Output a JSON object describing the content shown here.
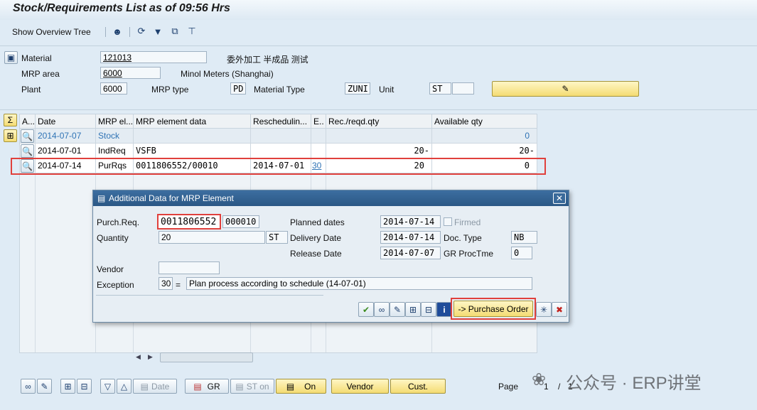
{
  "window": {
    "title": "Stock/Requirements List as of 09:56 Hrs"
  },
  "toolbar": {
    "show_overview_tree": "Show Overview Tree"
  },
  "header": {
    "material_label": "Material",
    "material_value": "121013",
    "material_desc": "委外加工 半成品 测试",
    "mrp_area_label": "MRP area",
    "mrp_area_value": "6000",
    "mrp_area_desc": "Minol Meters (Shanghai)",
    "plant_label": "Plant",
    "plant_value": "6000",
    "mrp_type_label": "MRP type",
    "mrp_type_value": "PD",
    "material_type_label": "Material Type",
    "material_type_value": "ZUNI",
    "unit_label": "Unit",
    "unit_value": "ST"
  },
  "grid": {
    "columns": [
      "A...",
      "Date",
      "MRP el...",
      "MRP element data",
      "Reschedulin...",
      "E..",
      "Rec./reqd.qty",
      "Available qty"
    ],
    "rows": [
      {
        "date": "2014-07-07",
        "mrp_el": "Stock",
        "element_data": "",
        "resched": "",
        "exc": "",
        "rec_qty": "",
        "avail_qty": "0"
      },
      {
        "date": "2014-07-01",
        "mrp_el": "IndReq",
        "element_data": "VSFB",
        "resched": "",
        "exc": "",
        "rec_qty": "20-",
        "avail_qty": "20-"
      },
      {
        "date": "2014-07-14",
        "mrp_el": "PurRqs",
        "element_data": "0011806552/00010",
        "resched": "2014-07-01",
        "exc": "30",
        "rec_qty": "20",
        "avail_qty": "0"
      }
    ]
  },
  "dialog": {
    "title": "Additional Data for MRP Element",
    "purch_req_label": "Purch.Req.",
    "purch_req_value": "0011806552",
    "purch_req_item": "000010",
    "quantity_label": "Quantity",
    "quantity_value": "20",
    "quantity_unit": "ST",
    "vendor_label": "Vendor",
    "vendor_value": "",
    "exception_label": "Exception",
    "exception_code": "30",
    "exception_eq": "=",
    "exception_text": "Plan process according to schedule (14-07-01)",
    "planned_dates_label": "Planned dates",
    "planned_dates_value": "2014-07-14",
    "firmed_label": "Firmed",
    "delivery_date_label": "Delivery Date",
    "delivery_date_value": "2014-07-14",
    "doc_type_label": "Doc. Type",
    "doc_type_value": "NB",
    "release_date_label": "Release Date",
    "release_date_value": "2014-07-07",
    "gr_proc_label": "GR ProcTme",
    "gr_proc_value": "0",
    "purchase_order_btn": "-> Purchase Order"
  },
  "bottom": {
    "date_btn": "Date",
    "gr_btn": "GR",
    "st_on_btn": "ST on",
    "on_btn": "On",
    "vendor_btn": "Vendor",
    "cust_btn": "Cust.",
    "page_label": "Page",
    "page_current": "1",
    "page_sep": "/",
    "page_total": "1"
  },
  "watermark": {
    "text": "公众号 · ERP讲堂"
  },
  "colors": {
    "accent_red": "#e0403c",
    "dialog_title_bg": "#2b5885",
    "button_yellow": "#f4dc73",
    "link_blue": "#2f73b5"
  }
}
